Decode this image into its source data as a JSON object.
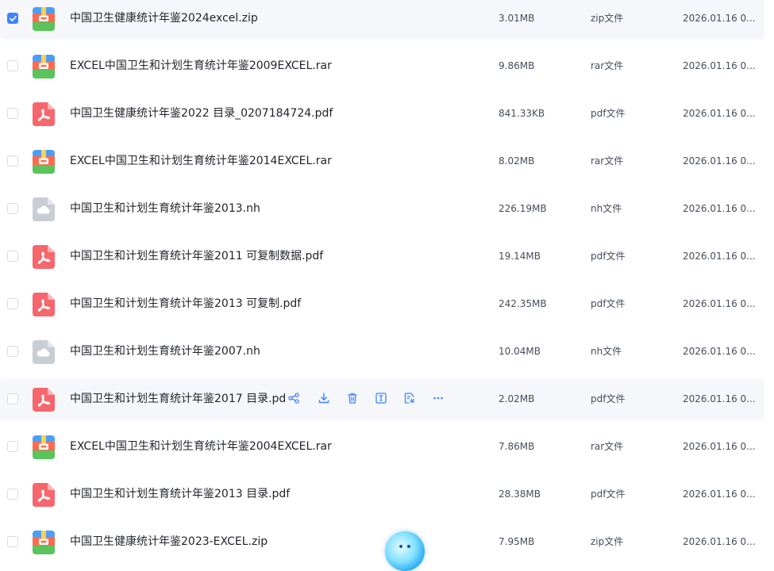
{
  "files": [
    {
      "name": "中国卫生健康统计年鉴2024excel.zip",
      "size": "3.01MB",
      "type": "zip文件",
      "date": "2026.01.16 0...",
      "icon": "archive-icon",
      "selected": true
    },
    {
      "name": "EXCEL中国卫生和计划生育统计年鉴2009EXCEL.rar",
      "size": "9.86MB",
      "type": "rar文件",
      "date": "2026.01.16 0...",
      "icon": "archive-icon",
      "selected": false
    },
    {
      "name": "中国卫生健康统计年鉴2022 目录_0207184724.pdf",
      "size": "841.33KB",
      "type": "pdf文件",
      "date": "2026.01.16 0...",
      "icon": "pdf-icon",
      "selected": false
    },
    {
      "name": "EXCEL中国卫生和计划生育统计年鉴2014EXCEL.rar",
      "size": "8.02MB",
      "type": "rar文件",
      "date": "2026.01.16 0...",
      "icon": "archive-icon",
      "selected": false
    },
    {
      "name": "中国卫生和计划生育统计年鉴2013.nh",
      "size": "226.19MB",
      "type": "nh文件",
      "date": "2026.01.16 0...",
      "icon": "cloud-file-icon",
      "selected": false
    },
    {
      "name": "中国卫生和计划生育统计年鉴2011 可复制数据.pdf",
      "size": "19.14MB",
      "type": "pdf文件",
      "date": "2026.01.16 0...",
      "icon": "pdf-icon",
      "selected": false
    },
    {
      "name": "中国卫生和计划生育统计年鉴2013 可复制.pdf",
      "size": "242.35MB",
      "type": "pdf文件",
      "date": "2026.01.16 0...",
      "icon": "pdf-icon",
      "selected": false
    },
    {
      "name": "中国卫生和计划生育统计年鉴2007.nh",
      "size": "10.04MB",
      "type": "nh文件",
      "date": "2026.01.16 0...",
      "icon": "cloud-file-icon",
      "selected": false
    },
    {
      "name": "中国卫生和计划生育统计年鉴2017 目录.pd",
      "size": "2.02MB",
      "type": "pdf文件",
      "date": "2026.01.16 0...",
      "icon": "pdf-icon",
      "selected": false,
      "hovered": true
    },
    {
      "name": "EXCEL中国卫生和计划生育统计年鉴2004EXCEL.rar",
      "size": "7.86MB",
      "type": "rar文件",
      "date": "2026.01.16 0...",
      "icon": "archive-icon",
      "selected": false
    },
    {
      "name": "中国卫生和计划生育统计年鉴2013 目录.pdf",
      "size": "28.38MB",
      "type": "pdf文件",
      "date": "2026.01.16 0...",
      "icon": "pdf-icon",
      "selected": false
    },
    {
      "name": "中国卫生健康统计年鉴2023-EXCEL.zip",
      "size": "7.95MB",
      "type": "zip文件",
      "date": "2026.01.16 0...",
      "icon": "archive-icon",
      "selected": false
    }
  ],
  "row_actions": [
    "share-icon",
    "download-icon",
    "delete-icon",
    "rename-icon",
    "open-with-icon",
    "more-icon"
  ],
  "colors": {
    "accent": "#3f83ff",
    "row_highlight": "#f5f7fb",
    "pdf": "#f5676d",
    "archive_top": "#4a9ff5",
    "archive_mid": "#fd6a50",
    "archive_bottom": "#5bc35b",
    "cloud_file": "#c9cdd4"
  }
}
